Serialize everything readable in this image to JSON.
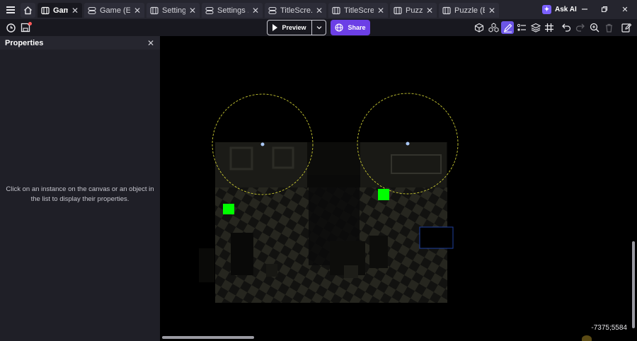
{
  "tabs": [
    {
      "label": "Game",
      "icon": "scene-icon",
      "active": true
    },
    {
      "label": "Game (E...",
      "icon": "events-icon",
      "active": false
    },
    {
      "label": "Settings",
      "icon": "scene-icon",
      "active": false
    },
    {
      "label": "Settings ...",
      "icon": "events-icon",
      "active": false
    },
    {
      "label": "TitleScre...",
      "icon": "events-icon",
      "active": false
    },
    {
      "label": "TitleScre...",
      "icon": "scene-icon",
      "active": false
    },
    {
      "label": "Puzzle",
      "icon": "scene-icon",
      "active": false
    },
    {
      "label": "Puzzle (E...",
      "icon": "events-icon",
      "active": false
    }
  ],
  "ask_ai": {
    "label": "Ask AI"
  },
  "toolbar": {
    "preview_label": "Preview",
    "share_label": "Share"
  },
  "panel": {
    "title": "Properties",
    "message": "Click on an instance on the canvas or an object in the list to display their properties."
  },
  "canvas": {
    "coordinates": "-7375;5584"
  },
  "colors": {
    "accent": "#6c3fe6",
    "selected_tool": "#6c56e6",
    "panel_bg": "#1f1f27",
    "tabbar_bg": "#25252e",
    "marker_green": "#00ff00",
    "circle_outline": "#c8c832"
  }
}
